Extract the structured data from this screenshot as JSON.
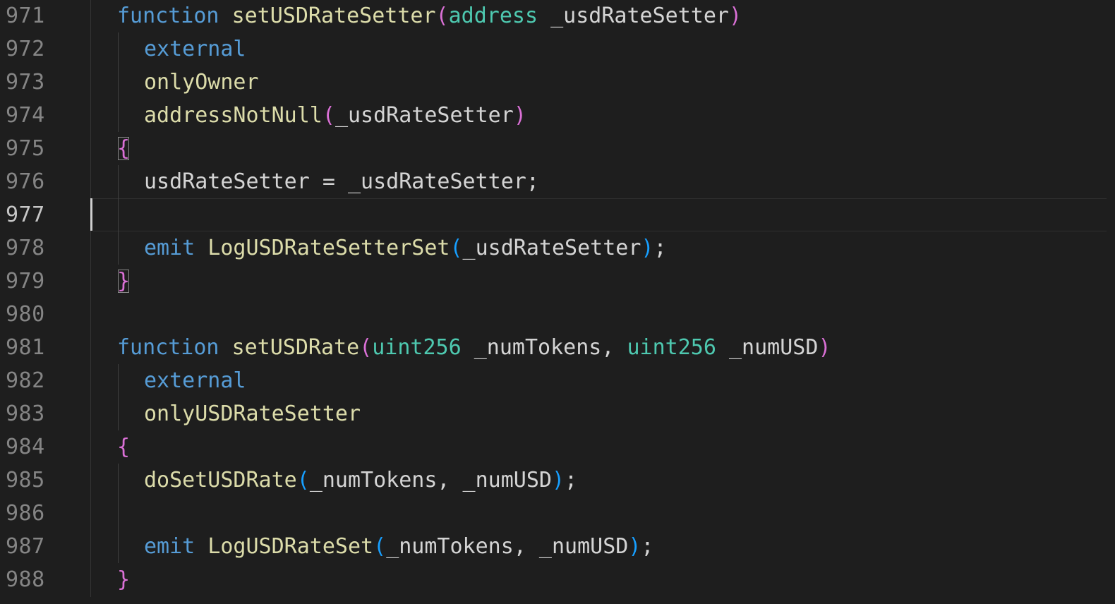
{
  "editor": {
    "active_line": "977",
    "colors": {
      "background": "#1e1e1e",
      "keyword": "#569cd6",
      "function": "#dcdcaa",
      "type": "#4ec9b0",
      "identifier": "#d4d4d4",
      "bracket_level1": "#da70d6",
      "bracket_level2": "#179fff"
    },
    "lines": [
      {
        "number": "971",
        "tokens": [
          {
            "t": "function",
            "c": "kw"
          },
          {
            "t": " "
          },
          {
            "t": "setUSDRateSetter",
            "c": "fn"
          },
          {
            "t": "(",
            "c": "b1"
          },
          {
            "t": "address",
            "c": "ty"
          },
          {
            "t": " _usdRateSetter",
            "c": "id"
          },
          {
            "t": ")",
            "c": "b1"
          }
        ]
      },
      {
        "number": "972",
        "tokens": [
          {
            "t": "external",
            "c": "kw"
          }
        ]
      },
      {
        "number": "973",
        "tokens": [
          {
            "t": "onlyOwner",
            "c": "fn"
          }
        ]
      },
      {
        "number": "974",
        "tokens": [
          {
            "t": "addressNotNull",
            "c": "fn"
          },
          {
            "t": "(",
            "c": "b1"
          },
          {
            "t": "_usdRateSetter",
            "c": "id"
          },
          {
            "t": ")",
            "c": "b1"
          }
        ]
      },
      {
        "number": "975",
        "tokens": [
          {
            "t": "{",
            "c": "b1 bb"
          }
        ]
      },
      {
        "number": "976",
        "tokens": [
          {
            "t": "usdRateSetter",
            "c": "id"
          },
          {
            "t": " = ",
            "c": "op"
          },
          {
            "t": "_usdRateSetter",
            "c": "id"
          },
          {
            "t": ";",
            "c": "op"
          }
        ]
      },
      {
        "number": "977",
        "tokens": []
      },
      {
        "number": "978",
        "tokens": [
          {
            "t": "emit",
            "c": "kw"
          },
          {
            "t": " "
          },
          {
            "t": "LogUSDRateSetterSet",
            "c": "fn"
          },
          {
            "t": "(",
            "c": "b2"
          },
          {
            "t": "_usdRateSetter",
            "c": "id"
          },
          {
            "t": ")",
            "c": "b2"
          },
          {
            "t": ";",
            "c": "op"
          }
        ]
      },
      {
        "number": "979",
        "tokens": [
          {
            "t": "}",
            "c": "b1 bb"
          }
        ]
      },
      {
        "number": "980",
        "tokens": []
      },
      {
        "number": "981",
        "tokens": [
          {
            "t": "function",
            "c": "kw"
          },
          {
            "t": " "
          },
          {
            "t": "setUSDRate",
            "c": "fn"
          },
          {
            "t": "(",
            "c": "b1"
          },
          {
            "t": "uint256",
            "c": "ty"
          },
          {
            "t": " _numTokens, ",
            "c": "id"
          },
          {
            "t": "uint256",
            "c": "ty"
          },
          {
            "t": " _numUSD",
            "c": "id"
          },
          {
            "t": ")",
            "c": "b1"
          }
        ]
      },
      {
        "number": "982",
        "tokens": [
          {
            "t": "external",
            "c": "kw"
          }
        ]
      },
      {
        "number": "983",
        "tokens": [
          {
            "t": "onlyUSDRateSetter",
            "c": "fn"
          }
        ]
      },
      {
        "number": "984",
        "tokens": [
          {
            "t": "{",
            "c": "b1"
          }
        ]
      },
      {
        "number": "985",
        "tokens": [
          {
            "t": "doSetUSDRate",
            "c": "fn"
          },
          {
            "t": "(",
            "c": "b2"
          },
          {
            "t": "_numTokens, _numUSD",
            "c": "id"
          },
          {
            "t": ")",
            "c": "b2"
          },
          {
            "t": ";",
            "c": "op"
          }
        ]
      },
      {
        "number": "986",
        "tokens": []
      },
      {
        "number": "987",
        "tokens": [
          {
            "t": "emit",
            "c": "kw"
          },
          {
            "t": " "
          },
          {
            "t": "LogUSDRateSet",
            "c": "fn"
          },
          {
            "t": "(",
            "c": "b2"
          },
          {
            "t": "_numTokens, _numUSD",
            "c": "id"
          },
          {
            "t": ")",
            "c": "b2"
          },
          {
            "t": ";",
            "c": "op"
          }
        ]
      },
      {
        "number": "988",
        "tokens": [
          {
            "t": "}",
            "c": "b1"
          }
        ]
      }
    ]
  }
}
